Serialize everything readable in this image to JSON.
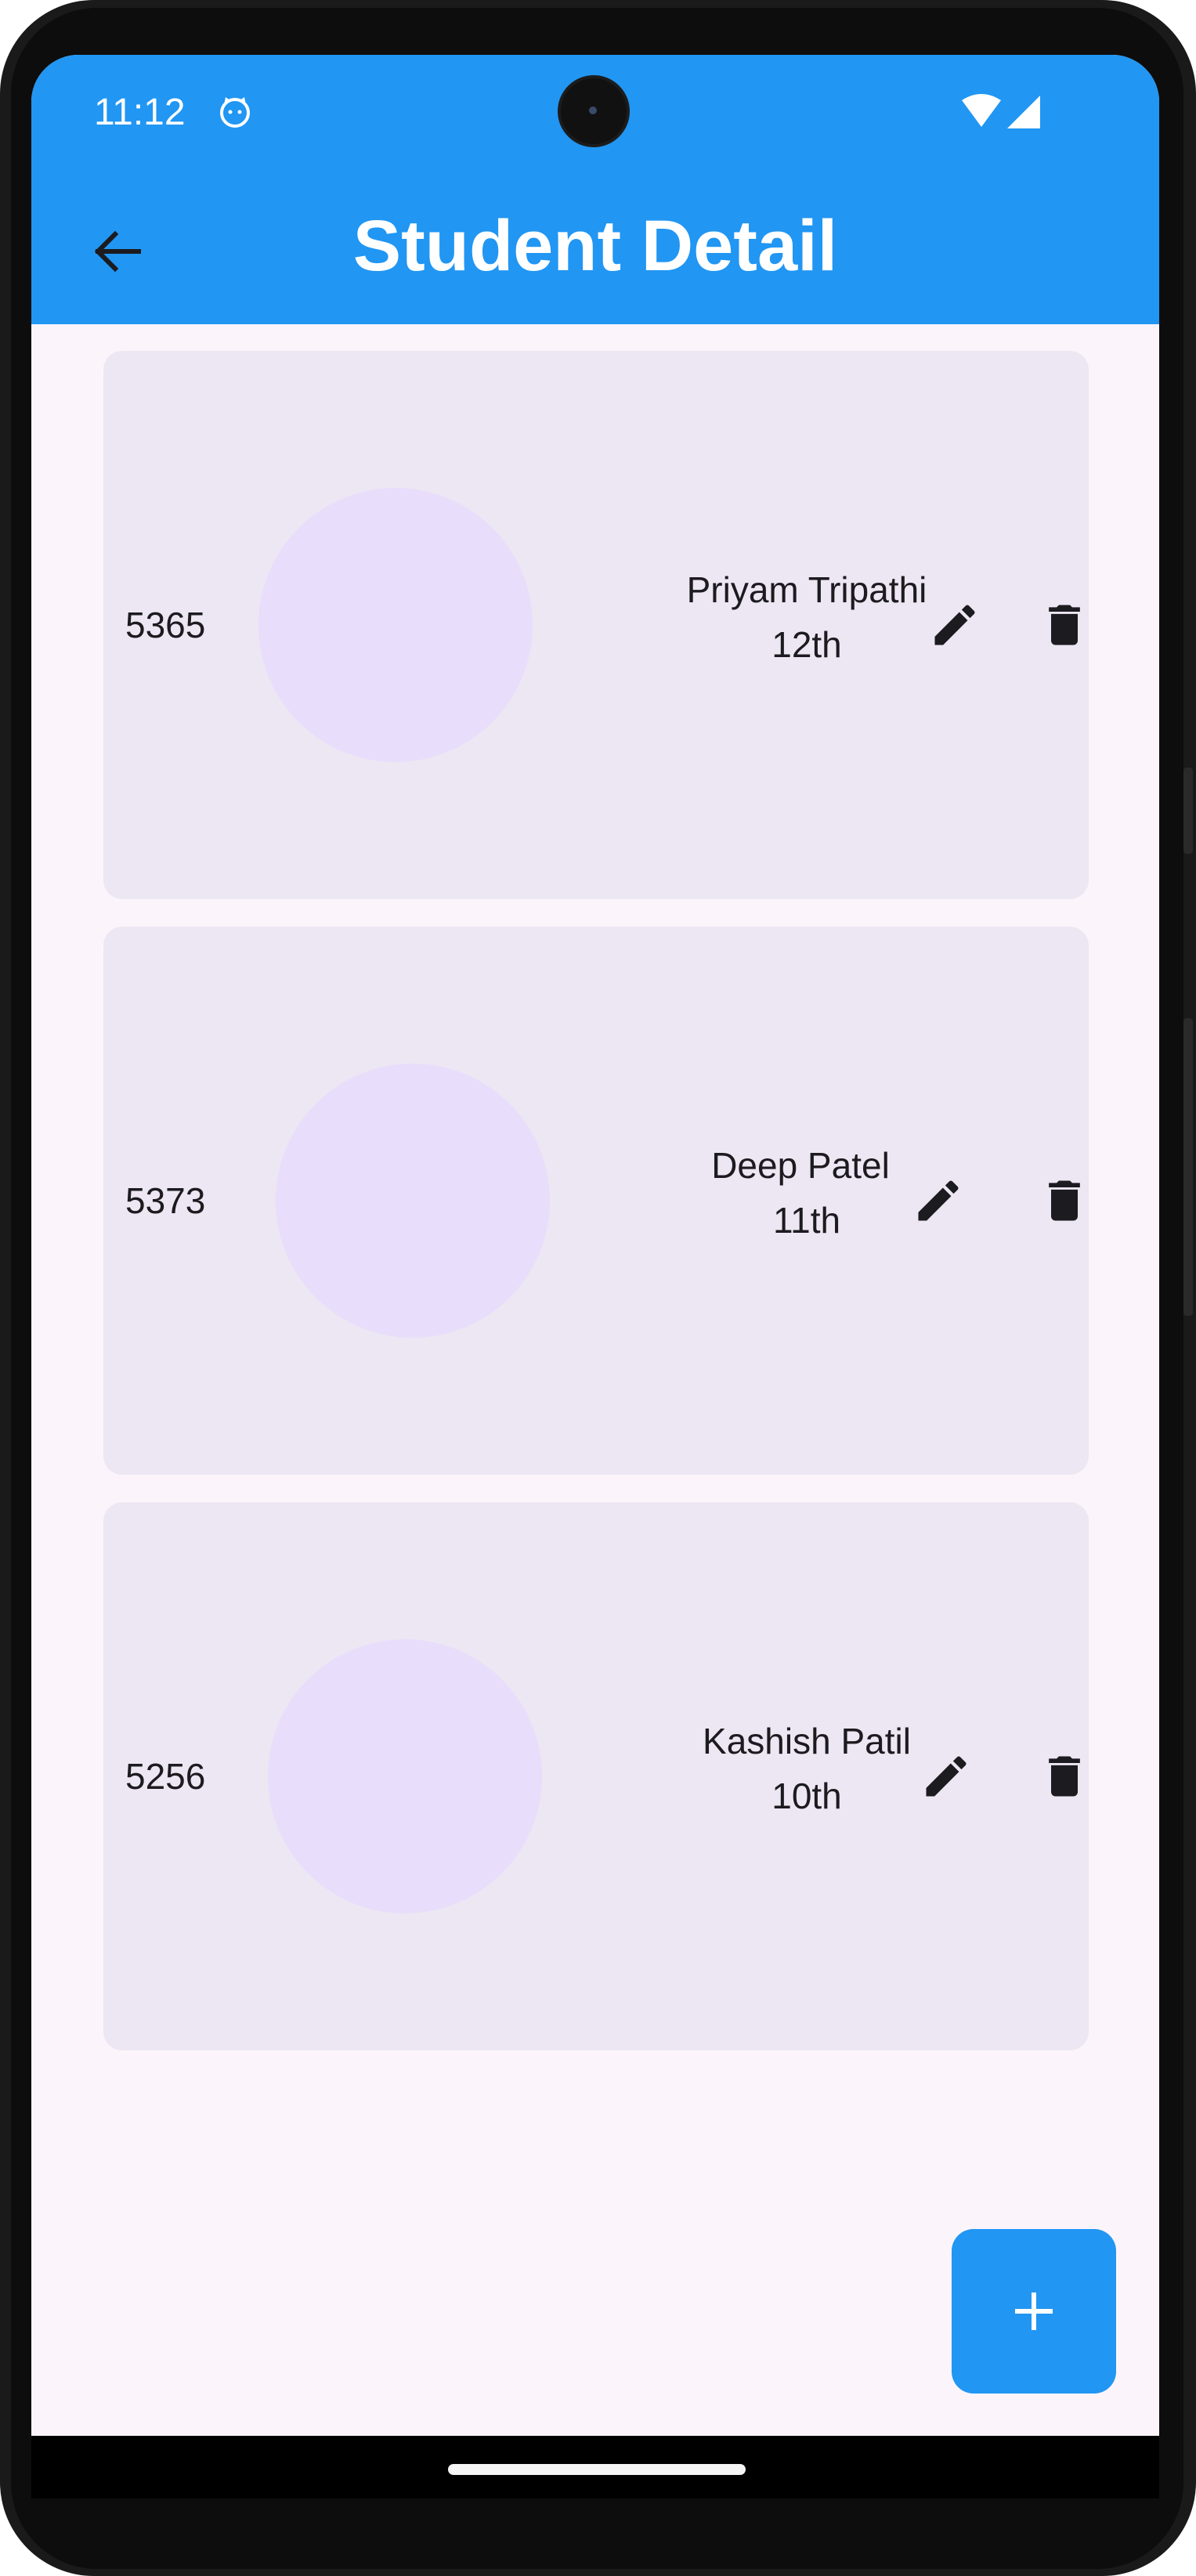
{
  "status_bar": {
    "time": "11:12",
    "notification_icon": "cat-face-icon",
    "wifi_icon": "wifi-icon",
    "signal_icon": "signal-icon"
  },
  "app_bar": {
    "title": "Student Detail",
    "back_icon": "arrow-back-icon",
    "color": "#2196f3"
  },
  "students": [
    {
      "id": "5365",
      "name": "Priyam Tripathi",
      "grade": "12th"
    },
    {
      "id": "5373",
      "name": "Deep Patel",
      "grade": "11th"
    },
    {
      "id": "5256",
      "name": "Kashish Patil",
      "grade": "10th"
    }
  ],
  "card_actions": {
    "edit_icon": "pencil-icon",
    "delete_icon": "trash-icon"
  },
  "fab": {
    "icon": "plus-icon",
    "color": "#2196f3"
  }
}
